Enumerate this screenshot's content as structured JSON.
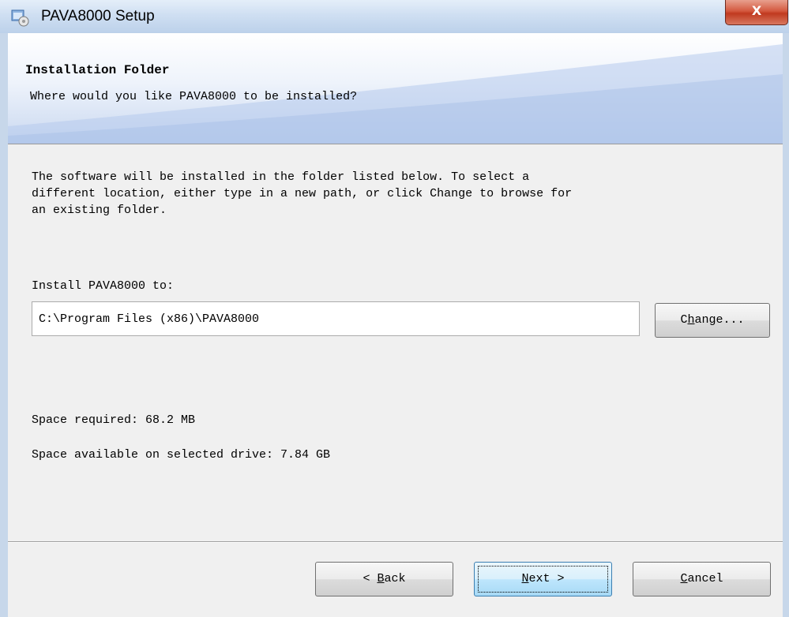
{
  "window": {
    "title": "PAVA8000 Setup",
    "close_label": "X"
  },
  "header": {
    "title": "Installation Folder",
    "subtitle": "Where would you like PAVA8000 to be installed?"
  },
  "body": {
    "description": "The software will be installed in the folder listed below. To select a\ndifferent location, either type in a new path, or click Change to browse for\nan existing folder.",
    "install_label": "Install PAVA8000 to:",
    "install_path": "C:\\Program Files (x86)\\PAVA8000",
    "change_button": {
      "label_pre": "C",
      "label_key": "h",
      "label_post": "ange..."
    },
    "space_required": "Space required: 68.2 MB",
    "space_available": "Space available on selected drive: 7.84 GB"
  },
  "footer": {
    "back_button": {
      "label_pre": "< ",
      "label_key": "B",
      "label_post": "ack"
    },
    "next_button": {
      "label_pre": "",
      "label_key": "N",
      "label_post": "ext >"
    },
    "cancel_button": {
      "label_pre": "",
      "label_key": "C",
      "label_post": "ancel"
    }
  },
  "icons": {
    "app": "setup-installer-icon",
    "close": "close-icon"
  },
  "colors": {
    "title_bar": "#cfdff2",
    "close_button": "#c7402a",
    "default_button_border": "#3c7fb1"
  }
}
